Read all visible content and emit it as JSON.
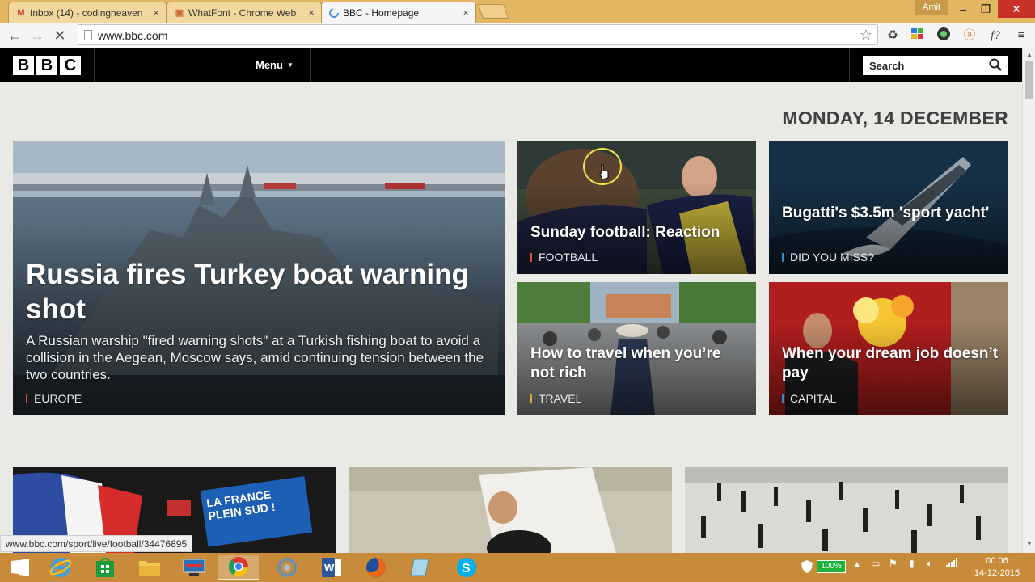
{
  "browser": {
    "tabs": [
      {
        "title": "Inbox (14) - codingheaven",
        "icon": "gmail-icon"
      },
      {
        "title": "WhatFont - Chrome Web",
        "icon": "webstore-icon"
      },
      {
        "title": "BBC - Homepage",
        "icon": "loading-spinner-icon",
        "active": true
      }
    ],
    "user": "Amit",
    "url": "www.bbc.com",
    "status_url": "www.bbc.com/sport/live/football/34476895"
  },
  "bbc": {
    "logo": [
      "B",
      "B",
      "C"
    ],
    "menu_label": "Menu",
    "search_placeholder": "Search",
    "date": "MONDAY, 14 DECEMBER"
  },
  "stories": {
    "main": {
      "headline": "Russia fires Turkey boat warning shot",
      "summary": "A Russian warship \"fired warning shots\" at a Turkish fishing boat to avoid a collision in the Aegean, Moscow says, amid continuing tension between the two countries.",
      "tag": "EUROPE"
    },
    "football": {
      "headline": "Sunday football: Reaction",
      "tag": "FOOTBALL"
    },
    "bugatti": {
      "headline": "Bugatti's $3.5m 'sport yacht'",
      "tag": "DID YOU MISS?"
    },
    "travel": {
      "headline": "How to travel when you’re not rich",
      "tag": "TRAVEL"
    },
    "capital": {
      "headline": "When your dream job doesn’t pay",
      "tag": "CAPITAL"
    },
    "low_sign": "LA FRANCE PLEIN SUD !"
  },
  "taskbar": {
    "apps": [
      "windows-start-icon",
      "internet-explorer-icon",
      "store-icon",
      "file-explorer-icon",
      "lenovo-icon",
      "chrome-icon",
      "app-icon",
      "word-icon",
      "firefox-icon",
      "notes-icon",
      "skype-icon"
    ],
    "battery": "100%",
    "time": "00:06",
    "date": "14-12-2015"
  },
  "colors": {
    "bbc_black": "#000000",
    "taskbar": "#c88b3a",
    "tabstrip": "#e3b661",
    "accent_red": "#e0512b"
  }
}
